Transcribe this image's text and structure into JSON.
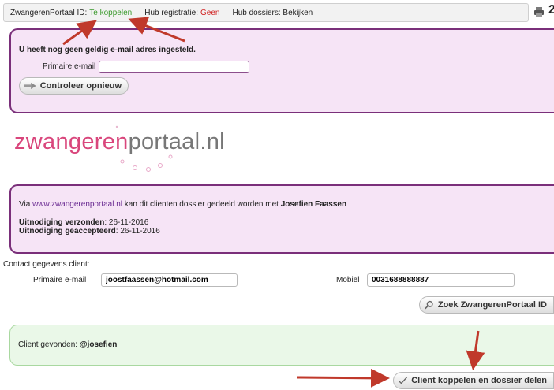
{
  "statusbar": {
    "portal_label": "ZwangerenPortaal ID:",
    "portal_value": "Te koppelen",
    "hub_reg_label": "Hub registratie:",
    "hub_reg_value": "Geen",
    "hub_dossiers": "Hub dossiers: Bekijken"
  },
  "email_warning": {
    "title": "U heeft nog geen geldig e-mail adres ingesteld.",
    "email_label": "Primaire e-mail",
    "email_value": "",
    "recheck_button": "Controleer opnieuw"
  },
  "logo": {
    "part1": "zwangeren",
    "part2": "portaal.nl"
  },
  "invite": {
    "via": "Via",
    "link": "www.zwangerenportaal.nl",
    "text_mid": "kan dit clienten dossier gedeeld worden met",
    "person": "Josefien Faassen",
    "sent_label": "Uitnodiging verzonden",
    "sent_value": ": 26-11-2016",
    "accepted_label": "Uitnodiging geaccepteerd",
    "accepted_value": ": 26-11-2016"
  },
  "contact": {
    "heading": "Contact gegevens client:",
    "email_label": "Primaire e-mail",
    "email_value": "joostfaassen@hotmail.com",
    "mobile_label": "Mobiel",
    "mobile_value": "0031688888887",
    "search_button": "Zoek ZwangerenPortaal ID"
  },
  "found": {
    "label": "Client gevonden:",
    "value": "@josefien"
  },
  "link_button": "Client koppelen en dossier delen",
  "colors": {
    "panel_border": "#7a2f7a",
    "panel_bg": "#f6e4f6",
    "found_bg": "#eaf8e8",
    "arrow": "#c0392b"
  }
}
